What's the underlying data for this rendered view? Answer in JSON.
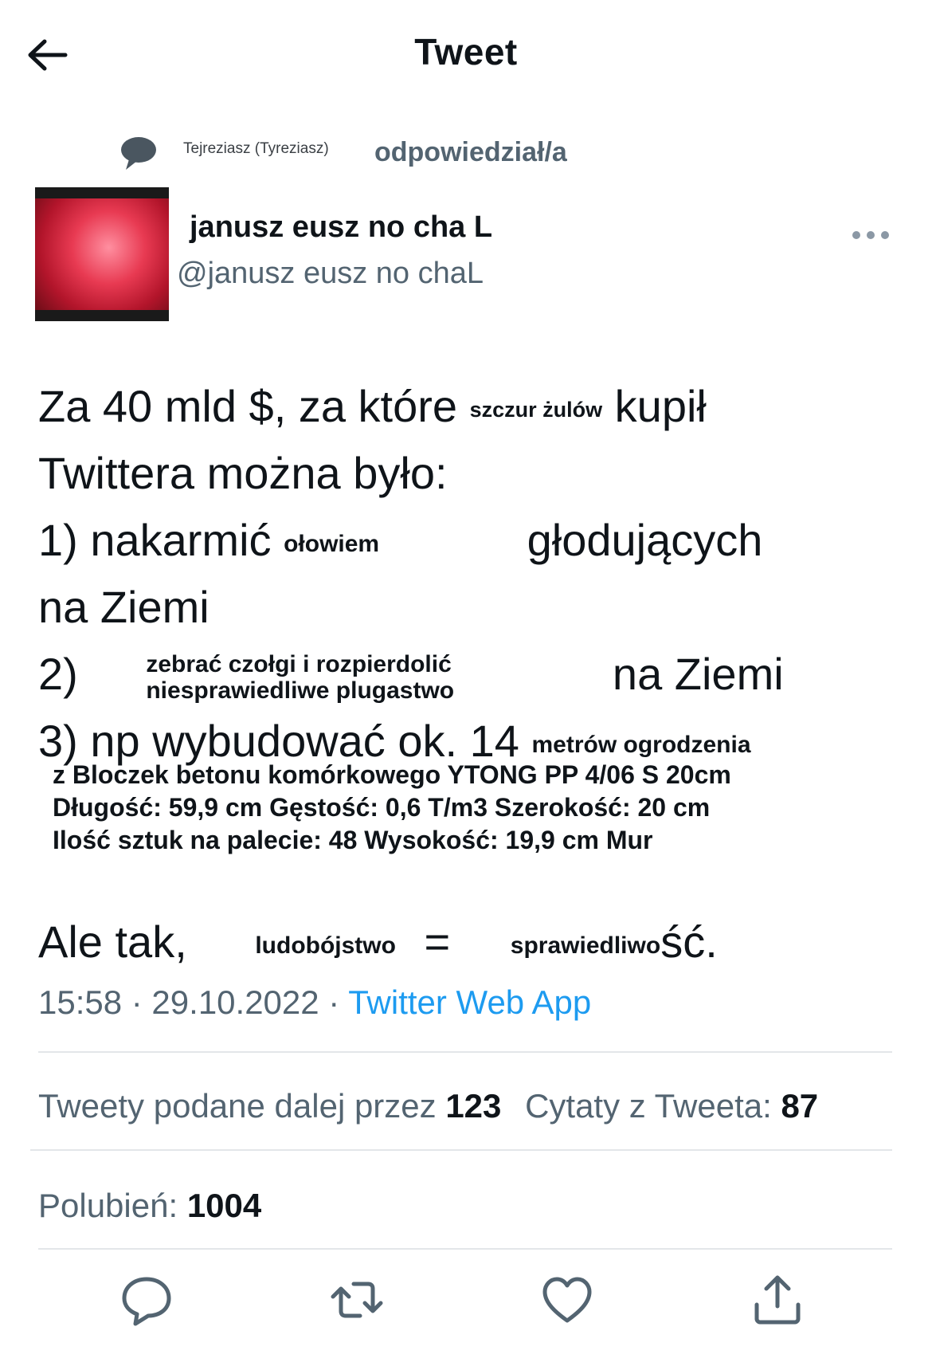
{
  "header": {
    "title": "Tweet"
  },
  "reply_context": {
    "user": "Tejreziasz (Tyreziasz)",
    "action": "odpowiedział/a"
  },
  "author": {
    "name": "janusz eusz no cha L",
    "handle": "@janusz eusz no chaL"
  },
  "tweet": {
    "line1_a": "Za 40 mld $, za które",
    "line1_overlay": "szczur żulów",
    "line1_b": "kupił",
    "line2": "Twittera można było:",
    "line3_a": "1) nakarmić",
    "line3_overlay": "ołowiem",
    "line3_b": "głodujących",
    "line4": "na Ziemi",
    "line5_a": "2)",
    "line5_overlay_1": "zebrać czołgi i rozpierdolić",
    "line5_overlay_2": "niesprawiedliwe plugastwo",
    "line5_b": "na Ziemi",
    "line6_a": "3) np wybudować ok. 14",
    "line6_overlay": "metrów ogrodzenia",
    "ytong_1": "z Bloczek betonu komórkowego YTONG PP 4/06 S 20cm",
    "ytong_2": "Długość: 59,9 cm Gęstość: 0,6 T/m3 Szerokość: 20 cm",
    "ytong_3": "Ilość sztuk na palecie: 48 Wysokość: 19,9 cm Mur",
    "line7_a": "Ale tak,",
    "line7_overlay_1": "ludobójstwo",
    "line7_eq": "=",
    "line7_overlay_2": "sprawiedliwo",
    "line7_b": "ść."
  },
  "meta": {
    "time_date": "15:58 · 29.10.2022 · ",
    "source": "Twitter Web App"
  },
  "stats": {
    "retweets_label": "Tweety podane dalej przez ",
    "retweets_count": "123",
    "quotes_label": "Cytaty z Tweeta: ",
    "quotes_count": "87",
    "likes_label": "Polubień: ",
    "likes_count": "1004"
  },
  "icons": {
    "back": "arrow-left-icon",
    "reply_context": "speech-bubble-icon",
    "more": "more-horizontal-icon",
    "reply": "reply-icon",
    "retweet": "retweet-icon",
    "like": "heart-icon",
    "share": "share-icon"
  },
  "colors": {
    "text": "#0f1419",
    "muted": "#536471",
    "accent": "#1d9bf0",
    "divider": "#e3e6e9"
  }
}
